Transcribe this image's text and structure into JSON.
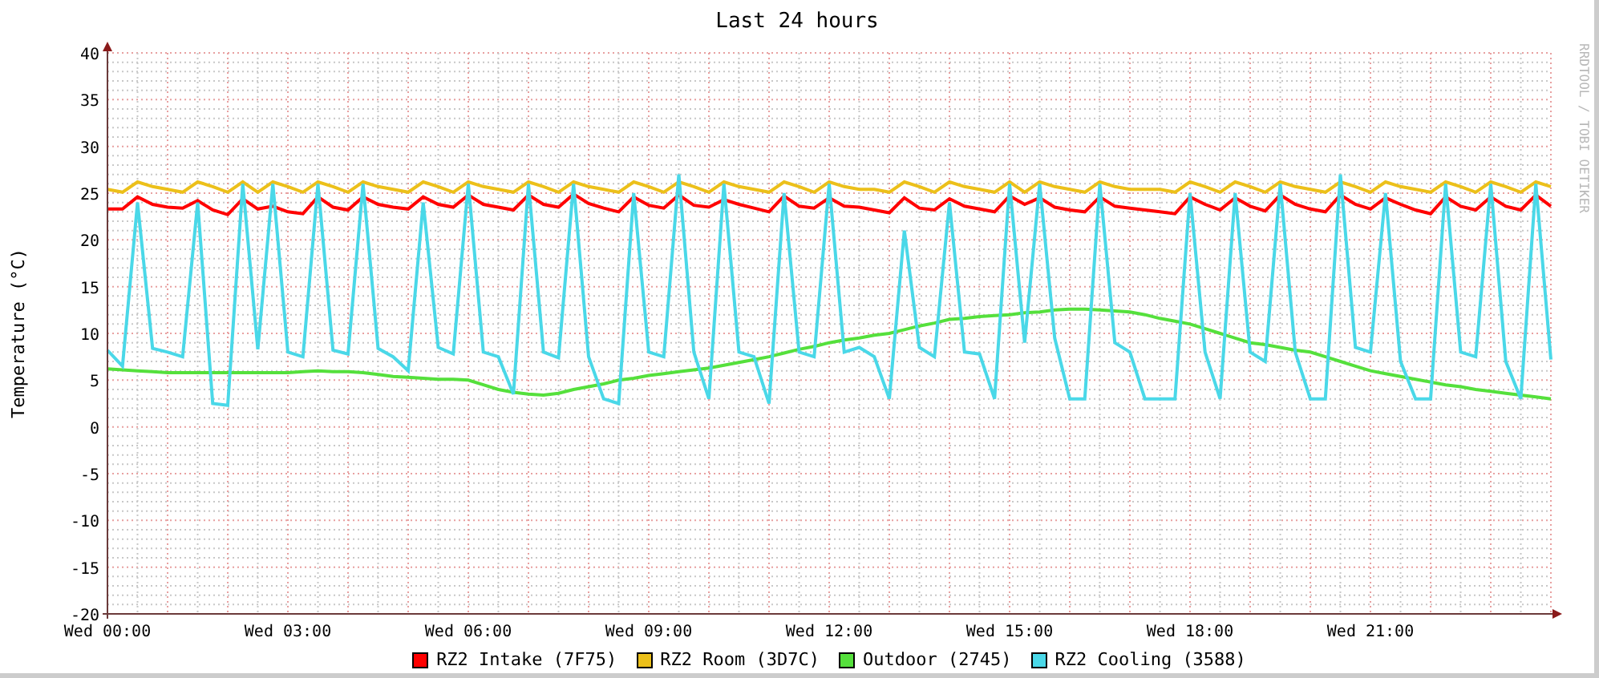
{
  "graph": {
    "credit": "RRDTOOL / TOBI OETIKER",
    "chart_data": {
      "type": "line",
      "title": "Last 24 hours",
      "ylabel": "Temperature (°C)",
      "categories": [
        "Wed 00:00",
        null,
        null,
        null,
        null,
        null,
        null,
        null,
        null,
        null,
        null,
        null,
        "Wed 03:00",
        null,
        null,
        null,
        null,
        null,
        null,
        null,
        null,
        null,
        null,
        null,
        "Wed 06:00",
        null,
        null,
        null,
        null,
        null,
        null,
        null,
        null,
        null,
        null,
        null,
        "Wed 09:00",
        null,
        null,
        null,
        null,
        null,
        null,
        null,
        null,
        null,
        null,
        null,
        "Wed 12:00",
        null,
        null,
        null,
        null,
        null,
        null,
        null,
        null,
        null,
        null,
        null,
        "Wed 15:00",
        null,
        null,
        null,
        null,
        null,
        null,
        null,
        null,
        null,
        null,
        null,
        "Wed 18:00",
        null,
        null,
        null,
        null,
        null,
        null,
        null,
        null,
        null,
        null,
        null,
        "Wed 21:00",
        null,
        null,
        null,
        null,
        null,
        null,
        null,
        null,
        null,
        null,
        null,
        null
      ],
      "ylim": [
        -20,
        40
      ],
      "grid": true,
      "yticks": [
        -20,
        -15,
        -10,
        -5,
        0,
        5,
        10,
        15,
        20,
        25,
        30,
        35,
        40
      ],
      "series": [
        {
          "name": "RZ2 Intake (7F75)",
          "color": "#ff0000",
          "values": [
            23.3,
            23.3,
            24.6,
            23.8,
            23.5,
            23.4,
            24.2,
            23.2,
            22.7,
            24.4,
            23.3,
            23.6,
            23,
            22.8,
            24.6,
            23.5,
            23.2,
            24.6,
            23.8,
            23.5,
            23.3,
            24.6,
            23.8,
            23.5,
            24.8,
            23.8,
            23.5,
            23.2,
            24.8,
            23.8,
            23.5,
            24.9,
            23.9,
            23.4,
            23,
            24.6,
            23.7,
            23.4,
            24.8,
            23.7,
            23.5,
            24.3,
            23.8,
            23.4,
            23,
            24.7,
            23.6,
            23.4,
            24.5,
            23.6,
            23.5,
            23.2,
            22.9,
            24.5,
            23.4,
            23.2,
            24.4,
            23.6,
            23.3,
            23,
            24.7,
            23.8,
            24.5,
            23.5,
            23.2,
            23,
            24.6,
            23.6,
            23.4,
            23.2,
            23,
            22.8,
            24.6,
            23.8,
            23.2,
            24.5,
            23.6,
            23.1,
            24.8,
            23.8,
            23.3,
            23,
            24.8,
            23.8,
            23.3,
            24.5,
            23.8,
            23.2,
            22.8,
            24.6,
            23.6,
            23.2,
            24.6,
            23.6,
            23.2,
            24.8,
            23.6
          ]
        },
        {
          "name": "RZ2 Room (3D7C)",
          "color": "#ecc01a",
          "values": [
            25.4,
            25.1,
            26.2,
            25.7,
            25.4,
            25.1,
            26.2,
            25.7,
            25.1,
            26.2,
            25.1,
            26.2,
            25.7,
            25.1,
            26.2,
            25.7,
            25.1,
            26.2,
            25.7,
            25.4,
            25.1,
            26.2,
            25.7,
            25.1,
            26.2,
            25.7,
            25.4,
            25.1,
            26.2,
            25.7,
            25.1,
            26.2,
            25.7,
            25.4,
            25.1,
            26.2,
            25.7,
            25.1,
            26.2,
            25.7,
            25.1,
            26.2,
            25.7,
            25.4,
            25.1,
            26.2,
            25.7,
            25.1,
            26.2,
            25.7,
            25.4,
            25.4,
            25.1,
            26.2,
            25.7,
            25.1,
            26.2,
            25.7,
            25.4,
            25.1,
            26.2,
            25.1,
            26.2,
            25.7,
            25.4,
            25.1,
            26.2,
            25.7,
            25.4,
            25.4,
            25.4,
            25.1,
            26.2,
            25.7,
            25.1,
            26.2,
            25.7,
            25.1,
            26.2,
            25.7,
            25.4,
            25.1,
            26.2,
            25.7,
            25.1,
            26.2,
            25.7,
            25.4,
            25.1,
            26.2,
            25.7,
            25.1,
            26.2,
            25.7,
            25.1,
            26.2,
            25.7
          ]
        },
        {
          "name": "Outdoor (2745)",
          "color": "#55e03c",
          "values": [
            6.2,
            6.1,
            6.0,
            5.9,
            5.8,
            5.8,
            5.8,
            5.8,
            5.8,
            5.8,
            5.8,
            5.8,
            5.8,
            5.9,
            6.0,
            5.9,
            5.9,
            5.8,
            5.6,
            5.4,
            5.3,
            5.2,
            5.1,
            5.1,
            5.0,
            4.5,
            4.0,
            3.7,
            3.5,
            3.4,
            3.6,
            4.0,
            4.3,
            4.6,
            5.0,
            5.2,
            5.5,
            5.7,
            5.9,
            6.1,
            6.3,
            6.6,
            6.9,
            7.2,
            7.5,
            7.9,
            8.3,
            8.6,
            9.0,
            9.3,
            9.5,
            9.8,
            10.0,
            10.4,
            10.8,
            11.1,
            11.5,
            11.6,
            11.8,
            11.9,
            12.0,
            12.2,
            12.3,
            12.5,
            12.6,
            12.6,
            12.5,
            12.4,
            12.3,
            12.0,
            11.6,
            11.3,
            11.0,
            10.5,
            10.0,
            9.5,
            9.0,
            8.8,
            8.5,
            8.2,
            8.0,
            7.5,
            7.0,
            6.5,
            6.0,
            5.7,
            5.4,
            5.1,
            4.8,
            4.5,
            4.3,
            4.0,
            3.8,
            3.6,
            3.4,
            3.2,
            3.0
          ]
        },
        {
          "name": "RZ2 Cooling (3588)",
          "color": "#4ad8e8",
          "values": [
            8.2,
            6.5,
            24,
            8.4,
            8,
            7.5,
            24,
            2.5,
            2.3,
            26,
            8.3,
            26,
            8,
            7.5,
            26,
            8.2,
            7.8,
            26,
            8.4,
            7.5,
            6,
            24,
            8.5,
            7.8,
            26,
            8,
            7.5,
            3.5,
            26,
            8,
            7.4,
            26,
            7.5,
            3,
            2.5,
            25,
            8,
            7.5,
            27,
            8,
            3,
            26,
            8,
            7.5,
            2.5,
            25,
            8,
            7.5,
            26,
            8,
            8.5,
            7.5,
            3,
            21,
            8.5,
            7.5,
            24,
            8,
            7.8,
            3,
            26,
            9,
            26,
            9.5,
            3,
            3,
            26,
            9,
            8,
            3,
            3,
            3,
            25,
            8,
            3,
            25,
            8,
            7,
            26,
            8,
            3,
            3,
            27,
            8.5,
            8,
            25,
            7,
            3,
            3,
            26,
            8,
            7.5,
            26,
            7,
            3,
            26,
            7.2
          ]
        }
      ]
    }
  }
}
